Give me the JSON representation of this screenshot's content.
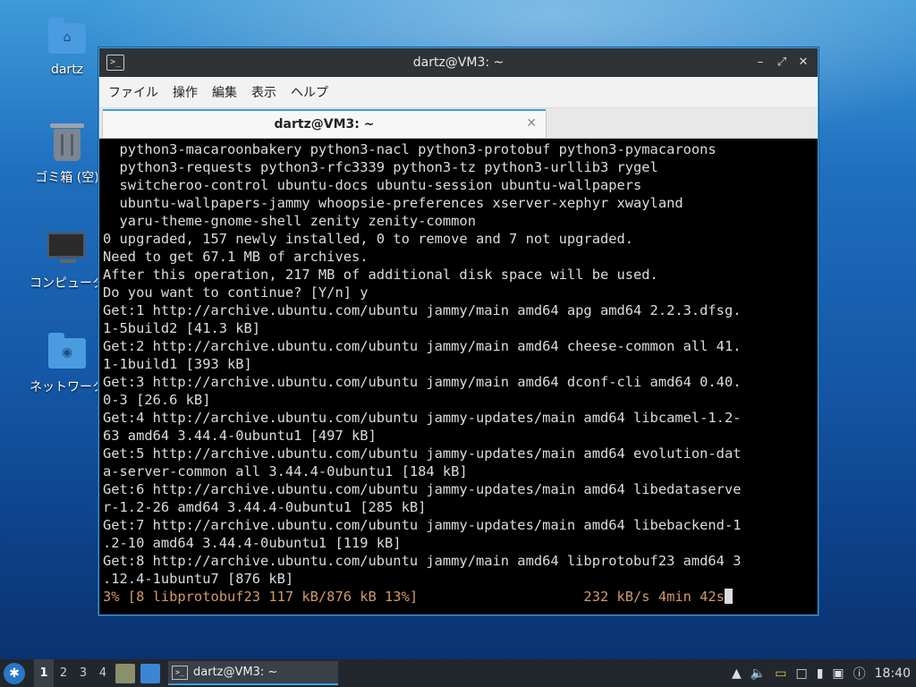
{
  "desktop": {
    "icons": [
      {
        "label": "dartz",
        "icon": "home-folder-icon"
      },
      {
        "label": "ゴミ箱 (空)",
        "icon": "trash-icon"
      },
      {
        "label": "コンピュータ",
        "icon": "computer-icon"
      },
      {
        "label": "ネットワーク",
        "icon": "network-folder-icon"
      }
    ]
  },
  "window": {
    "title": "dartz@VM3: ~",
    "app_icon": "terminal-icon",
    "controls": {
      "minimize": "–",
      "maximize": "⤢",
      "close": "✕"
    },
    "menu": [
      "ファイル",
      "操作",
      "編集",
      "表示",
      "ヘルプ"
    ],
    "tab": {
      "label": "dartz@VM3: ~",
      "close": "✕"
    },
    "terminal_lines": [
      "  python3-macaroonbakery python3-nacl python3-protobuf python3-pymacaroons",
      "  python3-requests python3-rfc3339 python3-tz python3-urllib3 rygel",
      "  switcheroo-control ubuntu-docs ubuntu-session ubuntu-wallpapers",
      "  ubuntu-wallpapers-jammy whoopsie-preferences xserver-xephyr xwayland",
      "  yaru-theme-gnome-shell zenity zenity-common",
      "0 upgraded, 157 newly installed, 0 to remove and 7 not upgraded.",
      "Need to get 67.1 MB of archives.",
      "After this operation, 217 MB of additional disk space will be used.",
      "Do you want to continue? [Y/n] y",
      "Get:1 http://archive.ubuntu.com/ubuntu jammy/main amd64 apg amd64 2.2.3.dfsg.",
      "1-5build2 [41.3 kB]",
      "Get:2 http://archive.ubuntu.com/ubuntu jammy/main amd64 cheese-common all 41.",
      "1-1build1 [393 kB]",
      "Get:3 http://archive.ubuntu.com/ubuntu jammy/main amd64 dconf-cli amd64 0.40.",
      "0-3 [26.6 kB]",
      "Get:4 http://archive.ubuntu.com/ubuntu jammy-updates/main amd64 libcamel-1.2-",
      "63 amd64 3.44.4-0ubuntu1 [497 kB]",
      "Get:5 http://archive.ubuntu.com/ubuntu jammy-updates/main amd64 evolution-dat",
      "a-server-common all 3.44.4-0ubuntu1 [184 kB]",
      "Get:6 http://archive.ubuntu.com/ubuntu jammy-updates/main amd64 libedataserve",
      "r-1.2-26 amd64 3.44.4-0ubuntu1 [285 kB]",
      "Get:7 http://archive.ubuntu.com/ubuntu jammy-updates/main amd64 libebackend-1",
      ".2-10 amd64 3.44.4-0ubuntu1 [119 kB]",
      "Get:8 http://archive.ubuntu.com/ubuntu jammy/main amd64 libprotobuf23 amd64 3",
      ".12.4-1ubuntu7 [876 kB]"
    ],
    "progress_line": "3% [8 libprotobuf23 117 kB/876 kB 13%]                    232 kB/s 4min 42s"
  },
  "taskbar": {
    "start_icon": "lubuntu-start-icon",
    "workspaces": [
      "1",
      "2",
      "3",
      "4"
    ],
    "active_workspace": "1",
    "task": {
      "label": "dartz@VM3: ~",
      "icon": "terminal-icon"
    },
    "clock": "18:40",
    "colors": {
      "accent": "#3aa0e8",
      "panel": "#22272d"
    }
  }
}
